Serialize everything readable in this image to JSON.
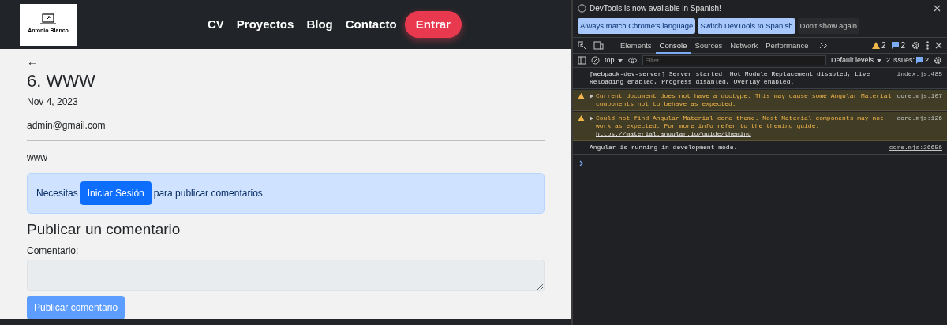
{
  "site": {
    "logo_text": "Antonio Blanco",
    "nav": [
      {
        "label": "CV"
      },
      {
        "label": "Proyectos"
      },
      {
        "label": "Blog"
      },
      {
        "label": "Contacto"
      }
    ],
    "login_button": "Entrar"
  },
  "post": {
    "back": "←",
    "title": "6. WWW",
    "date": "Nov 4, 2023",
    "author": "admin@gmail.com",
    "body": "www"
  },
  "alert": {
    "before": "Necesitas",
    "button": "Iniciar Sesión",
    "after": "para publicar comentarios"
  },
  "comment_form": {
    "heading": "Publicar un comentario",
    "label": "Comentario:",
    "disabled": true,
    "submit": "Publicar comentario"
  },
  "devtools": {
    "infobar": {
      "message": "DevTools is now available in Spanish!",
      "buttons": [
        {
          "label": "Always match Chrome's language",
          "kind": "primary"
        },
        {
          "label": "Switch DevTools to Spanish",
          "kind": "primary"
        },
        {
          "label": "Don't show again",
          "kind": "plain"
        }
      ]
    },
    "tabs": [
      {
        "label": "Elements",
        "selected": false
      },
      {
        "label": "Console",
        "selected": true
      },
      {
        "label": "Sources",
        "selected": false
      },
      {
        "label": "Network",
        "selected": false
      },
      {
        "label": "Performance",
        "selected": false
      }
    ],
    "warning_count": "2",
    "info_count": "2",
    "context": "top",
    "filter_placeholder": "Filter",
    "levels": "Default levels",
    "issues_label": "2 Issues:",
    "issues_count": "2",
    "messages": [
      {
        "kind": "log",
        "text": "[webpack-dev-server] Server started: Hot Module Replacement disabled, Live Reloading enabled, Progress disabled, Overlay enabled.",
        "source": "index.js:485"
      },
      {
        "kind": "warning",
        "text": "Current document does not have a doctype. This may cause some Angular Material components not to behave as expected.",
        "source": "core.mjs:107"
      },
      {
        "kind": "warning",
        "text": "Could not find Angular Material core theme. Most Material components may not work as expected. For more info refer to the theming guide:",
        "link": "https://material.angular.io/guide/theming",
        "source": "core.mjs:126"
      },
      {
        "kind": "log",
        "text": "Angular is running in development mode.",
        "source": "core.mjs:26656"
      }
    ]
  }
}
